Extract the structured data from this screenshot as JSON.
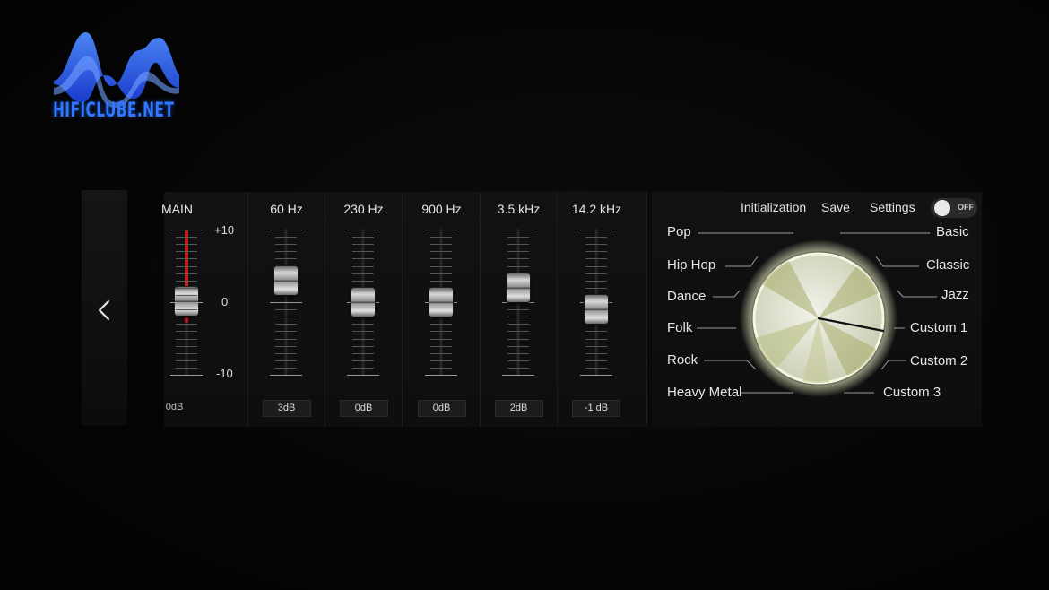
{
  "branding": {
    "logo_text": "HIFICLUBE.NET",
    "logo_color": "#2f78ff"
  },
  "navigation": {
    "back_icon": "chevron-left-icon"
  },
  "equalizer": {
    "main": {
      "label": "MAIN",
      "value_label": "0dB",
      "level": 0.0,
      "scale_top": "+10",
      "scale_mid": "0",
      "scale_bottom": "-10"
    },
    "bands": [
      {
        "label": "60 Hz",
        "value_label": "3dB",
        "value_db": 3
      },
      {
        "label": "230 Hz",
        "value_label": "0dB",
        "value_db": 0
      },
      {
        "label": "900 Hz",
        "value_label": "0dB",
        "value_db": 0
      },
      {
        "label": "3.5 kHz",
        "value_label": "2dB",
        "value_db": 2
      },
      {
        "label": "14.2 kHz",
        "value_label": "-1 dB",
        "value_db": -1
      }
    ]
  },
  "toolbar": {
    "initialization_label": "Initialization",
    "save_label": "Save",
    "settings_label": "Settings"
  },
  "toggle": {
    "state_label": "OFF"
  },
  "presets": {
    "left": [
      "Pop",
      "Hip Hop",
      "Dance",
      "Folk",
      "Rock",
      "Heavy Metal"
    ],
    "right": [
      "Basic",
      "Classic",
      "Jazz",
      "Custom 1",
      "Custom 2",
      "Custom 3"
    ],
    "selected": "Custom 1"
  },
  "colors": {
    "accent_red": "#c41c1c",
    "knob_glow": "#e8ecc4"
  }
}
